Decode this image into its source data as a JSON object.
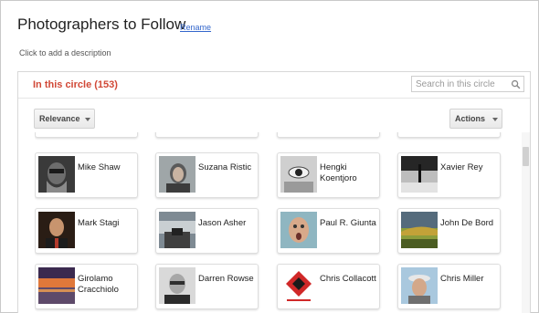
{
  "header": {
    "title": "Photographers to Follow",
    "rename_link": "Rename",
    "description_placeholder": "Click to add a description"
  },
  "circle": {
    "heading": "In this circle (153)",
    "search_placeholder": "Search in this circle",
    "sort_label": "Relevance",
    "actions_label": "Actions"
  },
  "accent_color": "#d14836",
  "link_color": "#3366cc",
  "people": [
    {
      "name": "Mike Shaw"
    },
    {
      "name": "Suzana Ristic"
    },
    {
      "name": "Hengki Koentjoro"
    },
    {
      "name": "Xavier Rey"
    },
    {
      "name": "Mark Stagi"
    },
    {
      "name": "Jason Asher"
    },
    {
      "name": "Paul R. Giunta"
    },
    {
      "name": "John De Bord"
    },
    {
      "name": "Girolamo Cracchiolo"
    },
    {
      "name": "Darren Rowse"
    },
    {
      "name": "Chris Collacott"
    },
    {
      "name": "Chris Miller"
    }
  ]
}
